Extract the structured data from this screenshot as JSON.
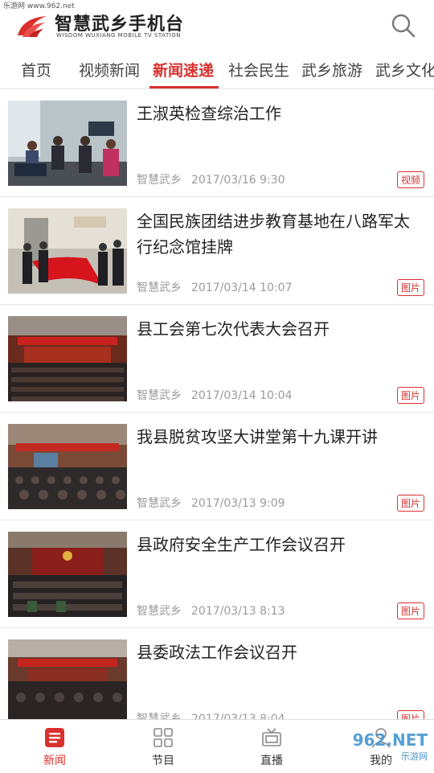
{
  "watermark_top": "乐游网 www.962.net",
  "header": {
    "title": "智慧武乡手机台",
    "subtitle": "WISDOM WUXIANG MOBILE TV STATION"
  },
  "tabs": [
    {
      "label": "首页",
      "active": false
    },
    {
      "label": "视频新闻",
      "active": false
    },
    {
      "label": "新闻速递",
      "active": true
    },
    {
      "label": "社会民生",
      "active": false
    },
    {
      "label": "武乡旅游",
      "active": false
    },
    {
      "label": "武乡文化",
      "active": false
    }
  ],
  "news": [
    {
      "title": "王淑英检查综治工作",
      "source": "智慧武乡",
      "time": "2017/03/16 9:30",
      "badge": "视频"
    },
    {
      "title": "全国民族团结进步教育基地在八路军太行纪念馆挂牌",
      "source": "智慧武乡",
      "time": "2017/03/14 10:07",
      "badge": "图片"
    },
    {
      "title": "县工会第七次代表大会召开",
      "source": "智慧武乡",
      "time": "2017/03/14 10:04",
      "badge": "图片"
    },
    {
      "title": "我县脱贫攻坚大讲堂第十九课开讲",
      "source": "智慧武乡",
      "time": "2017/03/13 9:09",
      "badge": "图片"
    },
    {
      "title": "县政府安全生产工作会议召开",
      "source": "智慧武乡",
      "time": "2017/03/13 8:13",
      "badge": "图片"
    },
    {
      "title": "县委政法工作会议召开",
      "source": "智慧武乡",
      "time": "2017/03/13 8:04",
      "badge": "图片"
    }
  ],
  "bottom_nav": [
    {
      "label": "新闻",
      "icon": "news-icon",
      "active": true
    },
    {
      "label": "节目",
      "icon": "grid-icon",
      "active": false
    },
    {
      "label": "直播",
      "icon": "tv-icon",
      "active": false
    },
    {
      "label": "我的",
      "icon": "user-icon",
      "active": false
    }
  ],
  "watermark_bottom": {
    "brand": "962.NET",
    "sub": "乐游网"
  },
  "colors": {
    "accent": "#d9302e"
  }
}
